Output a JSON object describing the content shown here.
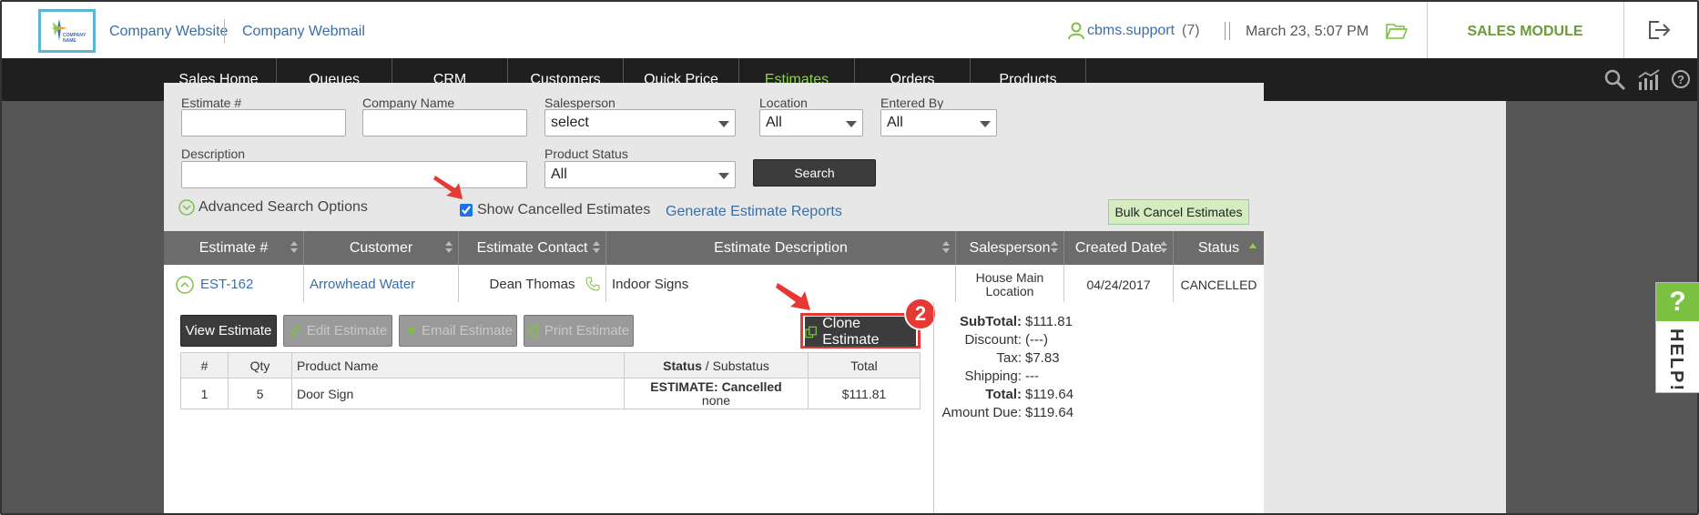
{
  "header": {
    "logo_text": "COMPANY NAME",
    "links": [
      "Company Website",
      "Company Webmail"
    ],
    "user": "cbms.support",
    "user_count": "(7)",
    "datetime": "March 23, 5:07 PM",
    "module": "SALES MODULE"
  },
  "nav": {
    "items": [
      "Sales Home",
      "Queues",
      "CRM",
      "Customers",
      "Quick Price",
      "Estimates",
      "Orders",
      "Products"
    ],
    "active": "Estimates",
    "icons": [
      "search-icon",
      "chart-icon",
      "help-icon"
    ]
  },
  "filters": {
    "estimate_label": "Estimate #",
    "company_label": "Company Name",
    "salesperson_label": "Salesperson",
    "salesperson_value": "select",
    "location_label": "Location",
    "location_value": "All",
    "entered_by_label": "Entered By",
    "entered_by_value": "All",
    "description_label": "Description",
    "product_status_label": "Product Status",
    "product_status_value": "All",
    "search_label": "Search",
    "advanced_label": "Advanced Search Options",
    "show_cancelled_label": "Show Cancelled Estimates",
    "show_cancelled_checked": true,
    "generate_reports_label": "Generate Estimate Reports",
    "bulk_cancel_label": "Bulk Cancel Estimates"
  },
  "table": {
    "headers": [
      "Estimate #",
      "Customer",
      "Estimate Contact",
      "Estimate Description",
      "Salesperson",
      "Created Date",
      "Status"
    ],
    "row": {
      "estimate": "EST-162",
      "customer": "Arrowhead Water",
      "contact": "Dean Thomas",
      "description": "Indoor Signs",
      "salesperson": "House Main Location",
      "created": "04/24/2017",
      "status": "CANCELLED"
    }
  },
  "detail": {
    "buttons": {
      "view": "View Estimate",
      "edit": "Edit Estimate",
      "email": "Email Estimate",
      "print": "Print Estimate",
      "clone": "Clone Estimate"
    },
    "step_badge": "2",
    "product_headers": {
      "num": "#",
      "qty": "Qty",
      "name": "Product Name",
      "status": "Status",
      "substatus": " / Substatus",
      "total": "Total"
    },
    "product_row": {
      "num": "1",
      "qty": "5",
      "name": "Door Sign",
      "status": "ESTIMATE: Cancelled",
      "substatus": "none",
      "total": "$111.81"
    },
    "totals": {
      "subtotal_label": "SubTotal:",
      "subtotal": "$111.81",
      "discount_label": "Discount:",
      "discount": "(---)",
      "tax_label": "Tax:",
      "tax": "$7.83",
      "shipping_label": "Shipping:",
      "shipping": "---",
      "total_label": "Total:",
      "total": "$119.64",
      "due_label": "Amount Due:",
      "due": "$119.64"
    }
  },
  "help_tab": {
    "q": "?",
    "label": "HELP!"
  },
  "colors": {
    "accent_green": "#8fd14f",
    "highlight_red": "#e53935",
    "link_blue": "#3a6fa6"
  }
}
